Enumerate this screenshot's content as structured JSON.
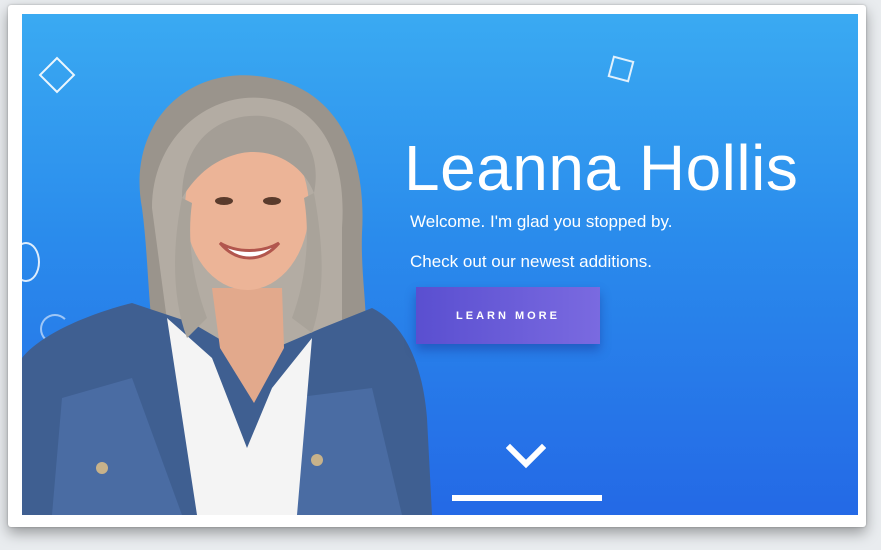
{
  "hero": {
    "name": "Leanna Hollis",
    "line1": "Welcome. I'm glad you stopped by.",
    "line2": "Check out our newest additions.",
    "button_label": "LEARN MORE",
    "scroll_icon": "chevron-down-icon"
  },
  "colors": {
    "gradient_top": "#3aaaf2",
    "gradient_bottom": "#2469e6",
    "button_start": "#5a4fd0",
    "button_end": "#7a6ae0",
    "text": "#ffffff"
  }
}
